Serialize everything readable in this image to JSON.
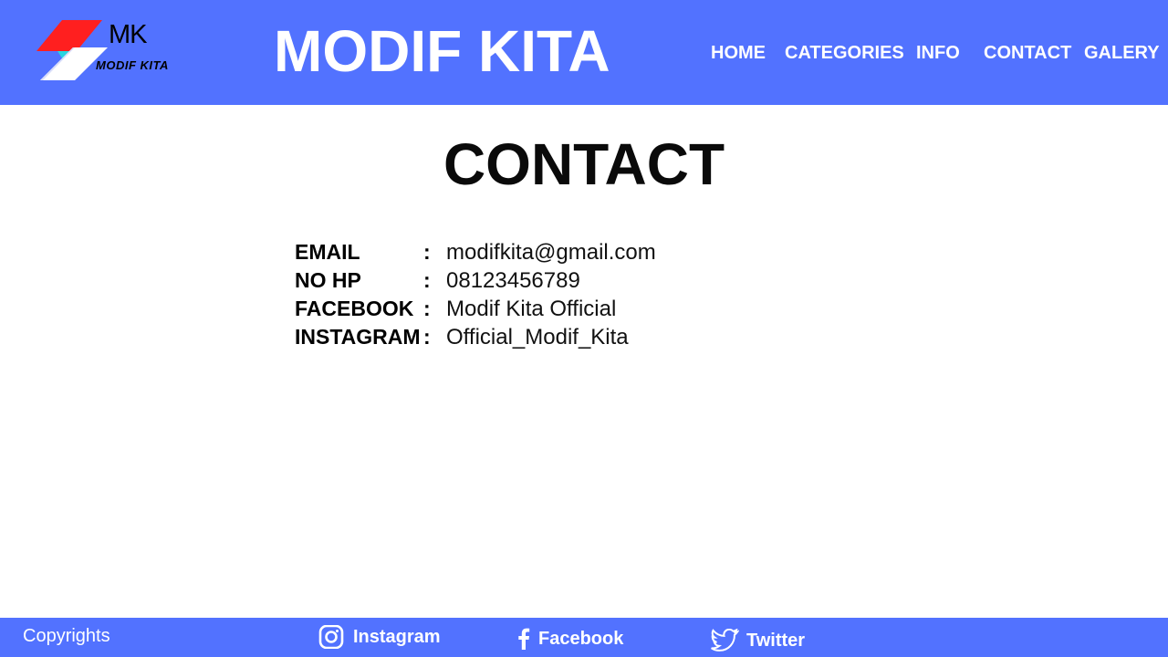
{
  "colors": {
    "header_bg": "#5272ff",
    "footer_bg": "#5272ff",
    "logo_red": "#ff1f1f",
    "logo_cyan": "#2ad4e0",
    "text_light": "#ffffff",
    "text_dark": "#000000"
  },
  "header": {
    "logo": {
      "mark": "MK",
      "subtitle": "MODIF KITA"
    },
    "title": "MODIF KITA",
    "nav": [
      {
        "label": "HOME"
      },
      {
        "label": "CATEGORIES"
      },
      {
        "label": "INFO"
      },
      {
        "label": "CONTACT"
      },
      {
        "label": "GALERY"
      }
    ]
  },
  "main": {
    "heading": "CONTACT",
    "contacts": [
      {
        "label": "EMAIL",
        "separator": ":",
        "value": "modifkita@gmail.com"
      },
      {
        "label": "NO HP",
        "separator": ":",
        "value": "08123456789"
      },
      {
        "label": "FACEBOOK",
        "separator": ":",
        "value": "Modif Kita Official"
      },
      {
        "label": "INSTAGRAM",
        "separator": ":",
        "value": "Official_Modif_Kita"
      }
    ]
  },
  "footer": {
    "copyright": "Copyrights",
    "social": [
      {
        "label": "Instagram",
        "icon": "instagram-icon"
      },
      {
        "label": "Facebook",
        "icon": "facebook-icon"
      },
      {
        "label": "Twitter",
        "icon": "twitter-icon"
      }
    ]
  }
}
